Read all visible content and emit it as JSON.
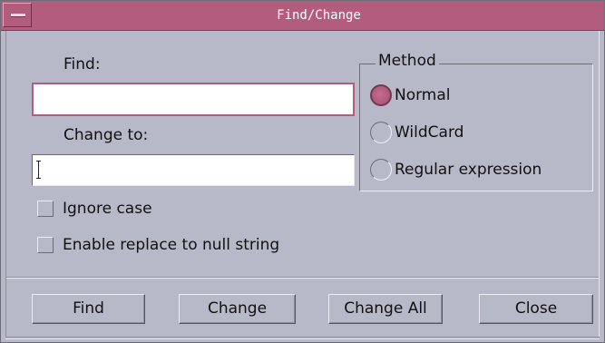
{
  "window": {
    "title": "Find/Change"
  },
  "find": {
    "label": "Find:",
    "value": ""
  },
  "change_to": {
    "label": "Change to:",
    "value": ""
  },
  "method": {
    "title": "Method",
    "options": [
      {
        "label": "Normal",
        "checked": true
      },
      {
        "label": "WildCard",
        "checked": false
      },
      {
        "label": "Regular expression",
        "checked": false
      }
    ]
  },
  "options": {
    "ignore_case": {
      "label": "Ignore case",
      "checked": false
    },
    "enable_null": {
      "label": "Enable replace to null string",
      "checked": false
    }
  },
  "buttons": {
    "find": "Find",
    "change": "Change",
    "change_all": "Change All",
    "close": "Close"
  },
  "colors": {
    "accent": "#b25c7e",
    "background": "#b8b9c8"
  }
}
